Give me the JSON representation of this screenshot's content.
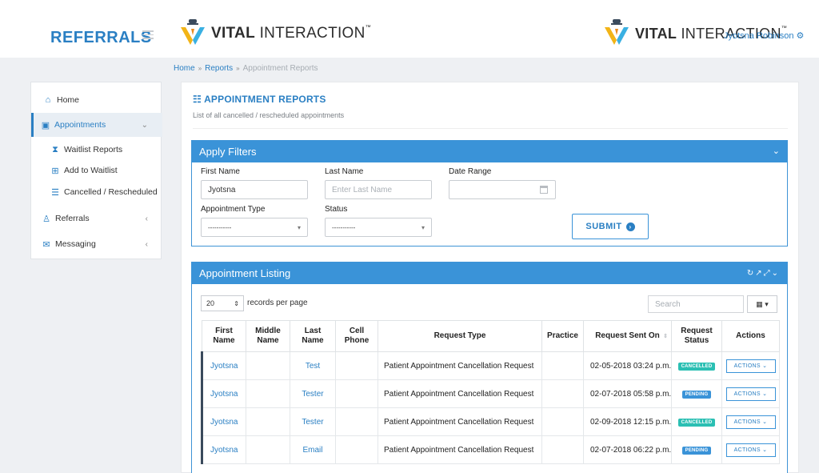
{
  "header": {
    "brand": "REFERRALS",
    "logo_bold": "VITAL",
    "logo_light": "INTERACTION",
    "logo_tm": "™",
    "user_name": "Jyotsna Robinson"
  },
  "breadcrumb": [
    "Home",
    "Reports",
    "Appointment Reports"
  ],
  "sidebar": {
    "items": [
      {
        "label": "Home",
        "icon": "home-icon"
      },
      {
        "label": "Appointments",
        "icon": "calendar-icon"
      },
      {
        "label": "Waitlist Reports",
        "icon": "hourglass-icon"
      },
      {
        "label": "Add to Waitlist",
        "icon": "plus-square-icon"
      },
      {
        "label": "Cancelled / Rescheduled",
        "icon": "list-icon"
      },
      {
        "label": "Referrals",
        "icon": "user-icon"
      },
      {
        "label": "Messaging",
        "icon": "chat-icon"
      }
    ]
  },
  "page": {
    "title": "APPOINTMENT REPORTS",
    "subtitle": "List of all cancelled / rescheduled appointments"
  },
  "filters": {
    "heading": "Apply Filters",
    "first_name_label": "First Name",
    "first_name_value": "Jyotsna",
    "last_name_label": "Last Name",
    "last_name_placeholder": "Enter Last Name",
    "date_range_label": "Date Range",
    "appt_type_label": "Appointment Type",
    "appt_type_value": "-----------",
    "status_label": "Status",
    "status_value": "-----------",
    "submit_label": "SUBMIT"
  },
  "listing": {
    "heading": "Appointment Listing",
    "per_page": "20",
    "per_page_label": "records per page",
    "search_placeholder": "Search",
    "columns": [
      "First Name",
      "Middle Name",
      "Last Name",
      "Cell Phone",
      "Request Type",
      "Practice",
      "Request Sent On",
      "Request Status",
      "Actions"
    ],
    "rows": [
      {
        "first": "Jyotsna",
        "middle": "",
        "last": "Test",
        "phone": "",
        "type": "Patient Appointment Cancellation Request",
        "practice": "",
        "sent": "02-05-2018 03:24 p.m.",
        "status": "CANCELLED",
        "action": "ACTIONS"
      },
      {
        "first": "Jyotsna",
        "middle": "",
        "last": "Tester",
        "phone": "",
        "type": "Patient Appointment Cancellation Request",
        "practice": "",
        "sent": "02-07-2018 05:58 p.m.",
        "status": "PENDING",
        "action": "ACTIONS"
      },
      {
        "first": "Jyotsna",
        "middle": "",
        "last": "Tester",
        "phone": "",
        "type": "Patient Appointment Cancellation Request",
        "practice": "",
        "sent": "02-09-2018 12:15 p.m.",
        "status": "CANCELLED",
        "action": "ACTIONS"
      },
      {
        "first": "Jyotsna",
        "middle": "",
        "last": "Email",
        "phone": "",
        "type": "Patient Appointment Cancellation Request",
        "practice": "",
        "sent": "02-07-2018 06:22 p.m.",
        "status": "PENDING",
        "action": "ACTIONS"
      }
    ]
  },
  "colors": {
    "accent": "#2a7fc3",
    "panel_header": "#3a93d8",
    "cancelled": "#2bbfb3",
    "pending": "#3a93d8"
  }
}
